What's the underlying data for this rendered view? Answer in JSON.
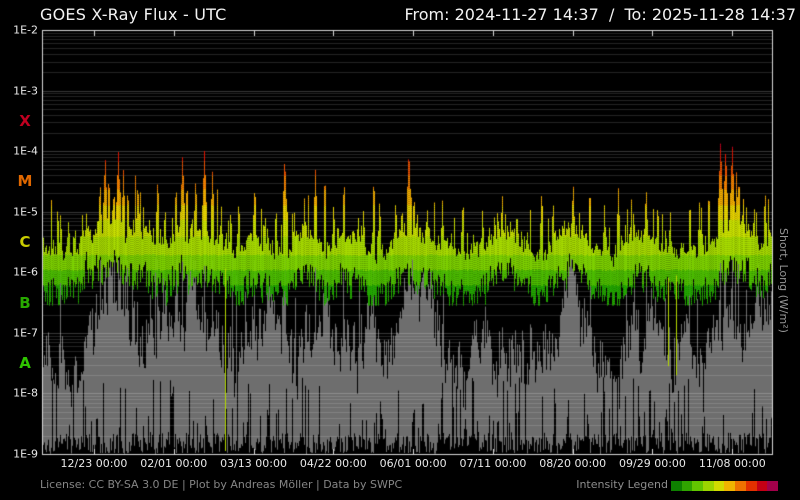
{
  "header": {
    "title": "GOES X-Ray Flux - UTC",
    "date_range": "From: 2024-11-27 14:37  /  To: 2025-11-28 14:37"
  },
  "footer": {
    "license": "License: CC BY-SA 3.0 DE | Plot by Andreas Möller | Data by SWPC",
    "legend_label": "Intensity Legend",
    "legend_colors": [
      "#0e8000",
      "#30a400",
      "#62c600",
      "#9cd600",
      "#d2dc00",
      "#f0b400",
      "#ee7200",
      "#e23000",
      "#c40014",
      "#a2004a"
    ]
  },
  "right_axis_label": "Short, Long (W/m²)",
  "colors": {
    "background": "#000000",
    "plot_border": "#d9d9d9",
    "grid_minor": "rgba(255,255,255,0.14)",
    "grid_major": "rgba(255,255,255,0.22)",
    "short_series_gray": "#6e6e6e",
    "text_primary": "#f2f2f2",
    "text_secondary": "#8d8d8d"
  },
  "chart_data": {
    "type": "line",
    "title": "GOES X-Ray Flux - UTC",
    "x_range": [
      "2024-11-27 14:37",
      "2025-11-28 14:37"
    ],
    "y_scale": "log",
    "ylim_log10": [
      -9,
      -2
    ],
    "grid": "on",
    "y_ticks": [
      {
        "label": "1E-2",
        "log": -2
      },
      {
        "label": "1E-3",
        "log": -3
      },
      {
        "label": "1E-4",
        "log": -4
      },
      {
        "label": "1E-5",
        "log": -5
      },
      {
        "label": "1E-6",
        "log": -6
      },
      {
        "label": "1E-7",
        "log": -7
      },
      {
        "label": "1E-8",
        "log": -8
      },
      {
        "label": "1E-9",
        "log": -9
      }
    ],
    "class_letters": [
      {
        "label": "X",
        "log_center": -3.5,
        "color": "#c00020"
      },
      {
        "label": "M",
        "log_center": -4.5,
        "color": "#e06800"
      },
      {
        "label": "C",
        "log_center": -5.5,
        "color": "#c9cc00"
      },
      {
        "label": "B",
        "log_center": -6.5,
        "color": "#28a800"
      },
      {
        "label": "A",
        "log_center": -7.5,
        "color": "#2fc400"
      }
    ],
    "x_ticks": [
      {
        "label": "12/23 00:00",
        "f": 0.0712
      },
      {
        "label": "02/01 00:00",
        "f": 0.1805
      },
      {
        "label": "03/13 00:00",
        "f": 0.2898
      },
      {
        "label": "04/22 00:00",
        "f": 0.3991
      },
      {
        "label": "06/01 00:00",
        "f": 0.5084
      },
      {
        "label": "07/11 00:00",
        "f": 0.6177
      },
      {
        "label": "08/20 00:00",
        "f": 0.727
      },
      {
        "label": "09/29 00:00",
        "f": 0.8363
      },
      {
        "label": "11/08 00:00",
        "f": 0.9456
      }
    ],
    "colormap_log10_stops": [
      [
        -6.2,
        "#22a800"
      ],
      [
        -5.95,
        "#4cbe00"
      ],
      [
        -5.7,
        "#7ed200"
      ],
      [
        -5.4,
        "#a8dc00"
      ],
      [
        -5.12,
        "#c8e000"
      ],
      [
        -4.88,
        "#e6d200"
      ],
      [
        -4.62,
        "#f0ac00"
      ],
      [
        -4.38,
        "#f28000"
      ],
      [
        -4.16,
        "#ec5200"
      ],
      [
        -3.96,
        "#e21600"
      ],
      [
        -3.78,
        "#c40020"
      ],
      [
        99,
        "#a60052"
      ]
    ],
    "series": [
      {
        "name": "long",
        "style": "intensity-colored",
        "baseline_log10": [
          [
            0.0,
            -5.62
          ],
          [
            0.015,
            -5.72
          ],
          [
            0.04,
            -5.78
          ],
          [
            0.06,
            -5.6
          ],
          [
            0.082,
            -5.4
          ],
          [
            0.1,
            -5.3
          ],
          [
            0.115,
            -5.4
          ],
          [
            0.135,
            -5.65
          ],
          [
            0.155,
            -5.55
          ],
          [
            0.175,
            -5.6
          ],
          [
            0.195,
            -5.4
          ],
          [
            0.215,
            -5.35
          ],
          [
            0.235,
            -5.55
          ],
          [
            0.26,
            -5.7
          ],
          [
            0.285,
            -5.6
          ],
          [
            0.305,
            -5.75
          ],
          [
            0.325,
            -5.85
          ],
          [
            0.345,
            -5.7
          ],
          [
            0.365,
            -5.6
          ],
          [
            0.385,
            -5.9
          ],
          [
            0.4,
            -5.75
          ],
          [
            0.415,
            -5.6
          ],
          [
            0.43,
            -5.7
          ],
          [
            0.445,
            -5.85
          ],
          [
            0.465,
            -5.95
          ],
          [
            0.48,
            -5.8
          ],
          [
            0.495,
            -5.55
          ],
          [
            0.51,
            -5.5
          ],
          [
            0.525,
            -5.65
          ],
          [
            0.545,
            -5.75
          ],
          [
            0.565,
            -5.95
          ],
          [
            0.585,
            -5.8
          ],
          [
            0.6,
            -5.7
          ],
          [
            0.615,
            -5.55
          ],
          [
            0.63,
            -5.5
          ],
          [
            0.645,
            -5.6
          ],
          [
            0.66,
            -5.75
          ],
          [
            0.675,
            -5.9
          ],
          [
            0.69,
            -5.8
          ],
          [
            0.705,
            -5.6
          ],
          [
            0.72,
            -5.45
          ],
          [
            0.735,
            -5.5
          ],
          [
            0.75,
            -5.6
          ],
          [
            0.765,
            -5.75
          ],
          [
            0.78,
            -5.85
          ],
          [
            0.795,
            -5.7
          ],
          [
            0.81,
            -5.6
          ],
          [
            0.825,
            -5.55
          ],
          [
            0.84,
            -5.65
          ],
          [
            0.855,
            -5.8
          ],
          [
            0.87,
            -5.75
          ],
          [
            0.885,
            -5.95
          ],
          [
            0.9,
            -6.0
          ],
          [
            0.915,
            -5.8
          ],
          [
            0.93,
            -5.55
          ],
          [
            0.945,
            -5.5
          ],
          [
            0.96,
            -5.55
          ],
          [
            0.975,
            -5.6
          ],
          [
            0.99,
            -5.55
          ],
          [
            1.0,
            -5.5
          ]
        ],
        "flares_log10_peaks": [
          [
            0.025,
            -4.95
          ],
          [
            0.036,
            -5.05
          ],
          [
            0.079,
            -4.45
          ],
          [
            0.086,
            -4.05
          ],
          [
            0.091,
            -4.35
          ],
          [
            0.098,
            -4.55
          ],
          [
            0.104,
            -3.98
          ],
          [
            0.111,
            -4.3
          ],
          [
            0.117,
            -4.55
          ],
          [
            0.134,
            -4.8
          ],
          [
            0.147,
            -5.0
          ],
          [
            0.158,
            -4.4
          ],
          [
            0.168,
            -4.85
          ],
          [
            0.183,
            -4.5
          ],
          [
            0.192,
            -4.03
          ],
          [
            0.198,
            -4.45
          ],
          [
            0.21,
            -4.4
          ],
          [
            0.222,
            -3.97
          ],
          [
            0.233,
            -4.3
          ],
          [
            0.245,
            -4.85
          ],
          [
            0.258,
            -4.9
          ],
          [
            0.269,
            -4.75
          ],
          [
            0.291,
            -4.5
          ],
          [
            0.305,
            -4.95
          ],
          [
            0.32,
            -4.85
          ],
          [
            0.332,
            -4.05
          ],
          [
            0.345,
            -4.95
          ],
          [
            0.359,
            -4.75
          ],
          [
            0.374,
            -4.3
          ],
          [
            0.387,
            -4.35
          ],
          [
            0.399,
            -4.8
          ],
          [
            0.413,
            -4.5
          ],
          [
            0.44,
            -4.9
          ],
          [
            0.454,
            -4.4
          ],
          [
            0.462,
            -4.75
          ],
          [
            0.484,
            -4.75
          ],
          [
            0.502,
            -3.93
          ],
          [
            0.509,
            -4.65
          ],
          [
            0.527,
            -4.85
          ],
          [
            0.548,
            -4.8
          ],
          [
            0.575,
            -5.0
          ],
          [
            0.603,
            -4.9
          ],
          [
            0.625,
            -5.05
          ],
          [
            0.65,
            -4.9
          ],
          [
            0.684,
            -4.6
          ],
          [
            0.7,
            -4.9
          ],
          [
            0.727,
            -4.5
          ],
          [
            0.75,
            -4.55
          ],
          [
            0.77,
            -4.85
          ],
          [
            0.789,
            -4.6
          ],
          [
            0.81,
            -4.9
          ],
          [
            0.827,
            -4.55
          ],
          [
            0.843,
            -4.8
          ],
          [
            0.86,
            -4.95
          ],
          [
            0.887,
            -4.75
          ],
          [
            0.9,
            -4.85
          ],
          [
            0.913,
            -4.6
          ],
          [
            0.929,
            -3.8
          ],
          [
            0.936,
            -3.92
          ],
          [
            0.945,
            -3.86
          ],
          [
            0.953,
            -4.45
          ],
          [
            0.96,
            -4.7
          ],
          [
            0.975,
            -4.85
          ],
          [
            0.99,
            -4.6
          ]
        ],
        "dropouts": [
          [
            0.25,
            -8.95
          ],
          [
            0.857,
            -7.55
          ],
          [
            0.869,
            -7.7
          ]
        ]
      },
      {
        "name": "short",
        "style": "gray-fill",
        "color": "#6e6e6e",
        "baseline_log10": [
          [
            0.0,
            -7.1
          ],
          [
            0.03,
            -7.5
          ],
          [
            0.06,
            -6.9
          ],
          [
            0.09,
            -6.3
          ],
          [
            0.115,
            -6.6
          ],
          [
            0.14,
            -7.3
          ],
          [
            0.17,
            -6.8
          ],
          [
            0.195,
            -6.2
          ],
          [
            0.22,
            -6.5
          ],
          [
            0.25,
            -7.4
          ],
          [
            0.28,
            -6.9
          ],
          [
            0.31,
            -6.6
          ],
          [
            0.34,
            -7.3
          ],
          [
            0.37,
            -6.7
          ],
          [
            0.4,
            -6.4
          ],
          [
            0.43,
            -7.0
          ],
          [
            0.46,
            -7.5
          ],
          [
            0.49,
            -6.4
          ],
          [
            0.515,
            -6.3
          ],
          [
            0.545,
            -6.9
          ],
          [
            0.575,
            -7.5
          ],
          [
            0.605,
            -7.0
          ],
          [
            0.635,
            -6.4
          ],
          [
            0.665,
            -6.7
          ],
          [
            0.695,
            -7.3
          ],
          [
            0.725,
            -6.3
          ],
          [
            0.755,
            -6.7
          ],
          [
            0.785,
            -7.4
          ],
          [
            0.815,
            -6.9
          ],
          [
            0.845,
            -6.4
          ],
          [
            0.875,
            -7.0
          ],
          [
            0.905,
            -7.4
          ],
          [
            0.935,
            -6.6
          ],
          [
            0.965,
            -7.0
          ],
          [
            1.0,
            -6.7
          ]
        ]
      }
    ]
  }
}
